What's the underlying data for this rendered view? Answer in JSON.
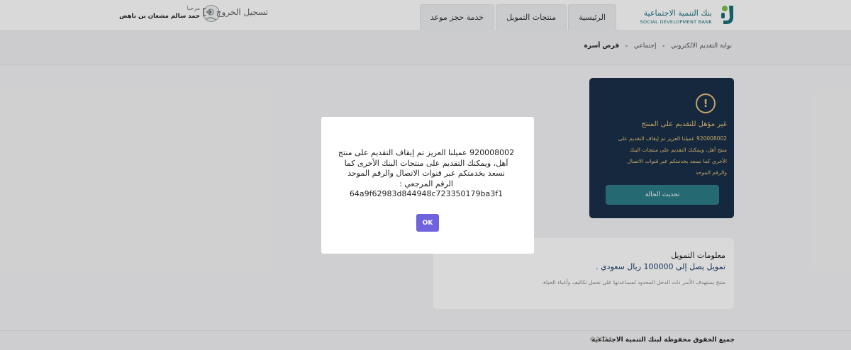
{
  "header": {
    "logo_ar": "بنك التنمية الاجتماعية",
    "logo_en": "SOCIAL DEVELOPMENT BANK",
    "nav": [
      {
        "label": "الرئيسية"
      },
      {
        "label": "منتجات التمويل"
      },
      {
        "label": "خدمة حجز موعد"
      }
    ],
    "welcome": "مرحبا",
    "username": "حمد سالم مشعان بن ناهض",
    "logout": "تسجيل الخروج"
  },
  "breadcrumb": {
    "items": [
      "بوابة التقديم الالكتروني",
      "إجتماعي",
      "قرض أسرة"
    ]
  },
  "status_card": {
    "title": "غير مؤهل للتقديم على المنتج",
    "message": "920008002 عميلنا العزيز تم إيقاف التقديم على منتج آهل، ويمكنك التقديم على منتجات البنك الأخرى كما نسعد بخدمتكم عبر قنوات الاتصال والرقم الموحد",
    "button": "تحديث الحالة"
  },
  "fund_card": {
    "title": "معلومات التمويل",
    "amount": "تمويل يصل إلى 100000 ريال سعودي .",
    "description": "منتج يستهدف الأسر ذات الدخل المحدود لمساعدتها على تحمل تكاليف وأعباء الحياة."
  },
  "footer": {
    "copyright": "جميع الحقوق محفوظة لبنك التنمية الاجتماعية",
    "year": "2024©"
  },
  "modal": {
    "line1": "920008002 عميلنا العزيز تم إيقاف التقديم على منتج",
    "line2": "آهل، ويمكنك التقديم على منتجات البنك الأخرى كما",
    "line3": "نسعد بخدمتكم عبر قنوات الاتصال والرقم الموحد",
    "line4": "الرقم المرجعي :",
    "line5": "64a9f62983d844948c723350179ba3f1",
    "ok": "OK"
  },
  "colors": {
    "brand": "#1d6f7a",
    "card_bg": "#1a3048",
    "warning": "#e4c27a",
    "ok_button": "#6f62dd"
  }
}
